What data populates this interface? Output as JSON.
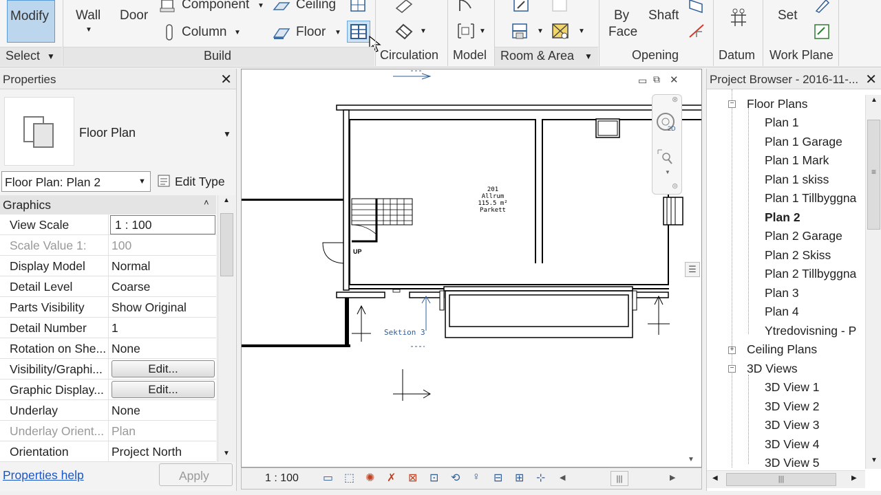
{
  "ribbon": {
    "modify": "Modify",
    "select": "Select",
    "build": {
      "wall": "Wall",
      "door": "Door",
      "component": "Component",
      "column": "Column",
      "ceiling": "Ceiling",
      "floor": "Floor",
      "label": "Build"
    },
    "circulation": "Circulation",
    "model": "Model",
    "room_area": "Room & Area",
    "opening": {
      "by": "By",
      "face": "Face",
      "shaft": "Shaft",
      "label": "Opening"
    },
    "datum": "Datum",
    "work_plane": {
      "set": "Set",
      "label": "Work Plane"
    }
  },
  "properties": {
    "title": "Properties",
    "type_name": "Floor Plan",
    "instance_selector": "Floor Plan: Plan 2",
    "edit_type": "Edit Type",
    "group": "Graphics",
    "rows": [
      {
        "label": "View Scale",
        "value": "1 : 100"
      },
      {
        "label": "Scale Value    1:",
        "value": "100"
      },
      {
        "label": "Display Model",
        "value": "Normal"
      },
      {
        "label": "Detail Level",
        "value": "Coarse"
      },
      {
        "label": "Parts Visibility",
        "value": "Show Original"
      },
      {
        "label": "Detail Number",
        "value": "1"
      },
      {
        "label": "Rotation on She...",
        "value": "None"
      },
      {
        "label": "Visibility/Graphi...",
        "value": "Edit..."
      },
      {
        "label": "Graphic Display...",
        "value": "Edit..."
      },
      {
        "label": "Underlay",
        "value": "None"
      },
      {
        "label": "Underlay Orient...",
        "value": "Plan"
      },
      {
        "label": "Orientation",
        "value": "Project North"
      }
    ],
    "help": "Properties help",
    "apply": "Apply"
  },
  "canvas": {
    "room_number": "201",
    "room_name": "Allrum",
    "room_area": "115.5 m²",
    "room_floor": "Parkett",
    "up": "UP",
    "section": "Sektion 3",
    "viewcube_2d": "2D",
    "scale": "1 : 100"
  },
  "browser": {
    "title": "Project Browser - 2016-11-...",
    "floor_plans": "Floor Plans",
    "plans": [
      "Plan 1",
      "Plan 1 Garage",
      "Plan 1 Mark",
      "Plan 1 skiss",
      "Plan 1 Tillbyggna",
      "Plan 2",
      "Plan 2 Garage",
      "Plan 2 Skiss",
      "Plan 2 Tillbyggna",
      "Plan 3",
      "Plan 4",
      "Ytredovisning - P"
    ],
    "ceiling_plans": "Ceiling Plans",
    "views_3d": "3D Views",
    "views": [
      "3D View 1",
      "3D View 2",
      "3D View 3",
      "3D View 4",
      "3D View 5"
    ]
  }
}
